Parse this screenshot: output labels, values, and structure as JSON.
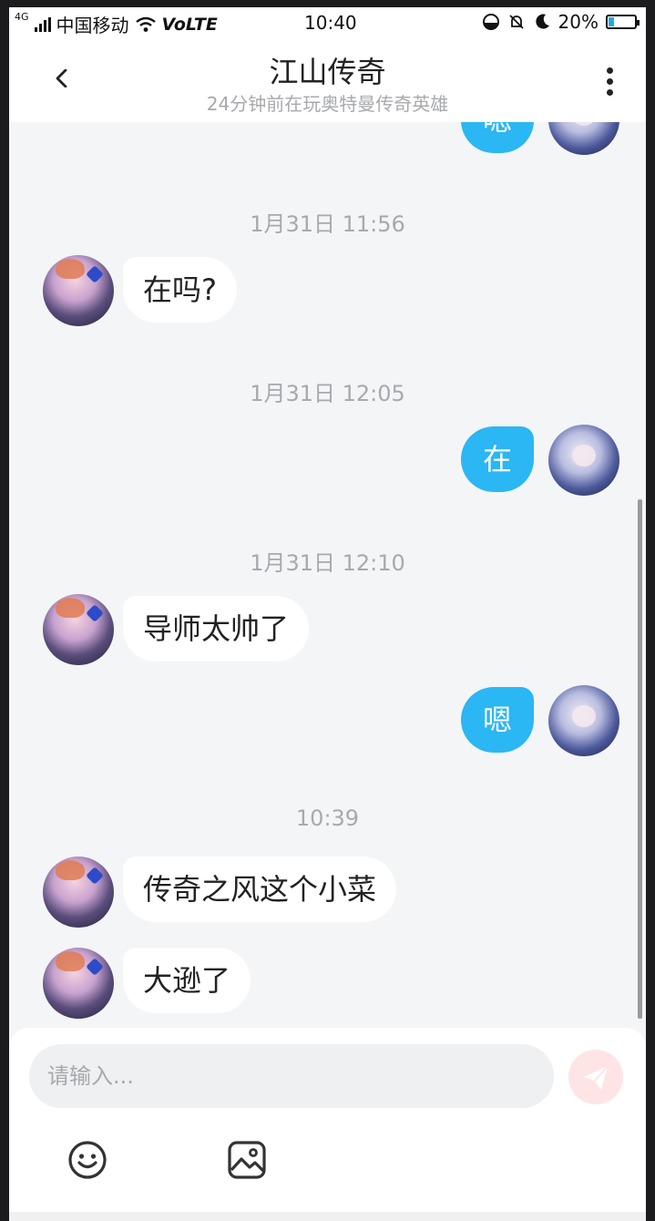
{
  "status_bar": {
    "network": "4G",
    "carrier": "中国移动",
    "volte": "VoLTE",
    "time": "10:40",
    "battery": "20%",
    "battery_level": 0.2
  },
  "header": {
    "title": "江山传奇",
    "subtitle": "24分钟前在玩奥特曼传奇英雄"
  },
  "chat": {
    "partial_top_message": "嗯",
    "items": [
      {
        "type": "time",
        "text": "1月31日 11:56"
      },
      {
        "type": "incoming",
        "text": "在吗?"
      },
      {
        "type": "time",
        "text": "1月31日 12:05"
      },
      {
        "type": "outgoing",
        "text": "在"
      },
      {
        "type": "time",
        "text": "1月31日 12:10"
      },
      {
        "type": "incoming",
        "text": "导师太帅了"
      },
      {
        "type": "outgoing",
        "text": "嗯"
      },
      {
        "type": "time",
        "text": "10:39"
      },
      {
        "type": "incoming",
        "text": "传奇之风这个小菜"
      },
      {
        "type": "incoming",
        "text": "大逊了"
      }
    ]
  },
  "composer": {
    "placeholder": "请输入...",
    "send_icon": "send-icon",
    "emoji_icon": "emoji-icon",
    "image_icon": "image-icon"
  },
  "colors": {
    "outgoing_bubble": "#2bb6f4",
    "incoming_bubble": "#ffffff",
    "background": "#f4f5f7",
    "send_button": "#ffe4e6"
  }
}
